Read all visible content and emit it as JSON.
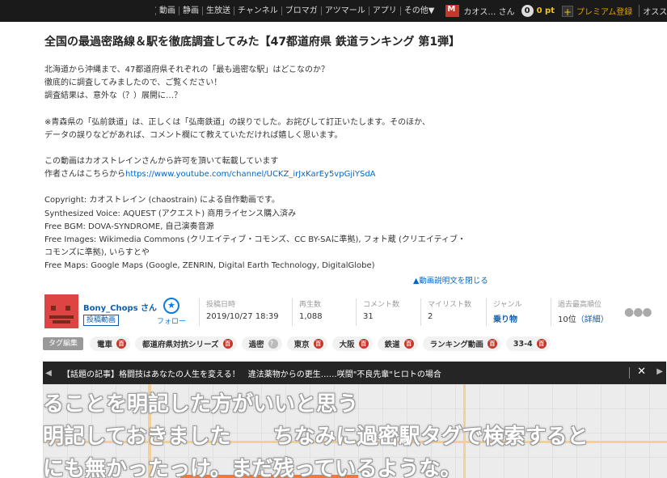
{
  "topbar": {
    "nav": [
      "動画",
      "静画",
      "生放送",
      "チャンネル",
      "ブロマガ",
      "アツマール",
      "アプリ",
      "その他▼"
    ],
    "user": "カオス… さん",
    "points": "0 pt",
    "premium": "プレミアム登録",
    "osusume": "オススメ"
  },
  "video": {
    "title": "全国の最過密路線＆駅を徹底調査してみた【47都道府県 鉄道ランキング 第1弾】",
    "description": [
      [
        "北海道から沖縄まで、47都道府県それぞれの「最も過密な駅」はどこなのか？",
        "徹底的に調査してみましたので、ご覧ください！",
        "調査結果は、意外な（？）展開に…？"
      ],
      [
        "※青森県の「弘前鉄道」は、正しくは「弘南鉄道」の誤りでした。お詫びして訂正いたします。そのほか、",
        "データの誤りなどがあれば、コメント欄にて教えていただければ嬉しく思います。"
      ],
      [
        "この動画はカオストレインさんから許可を頂いて転載しています"
      ],
      [
        "Copyright: カオストレイン (chaostrain) による自作動画です。",
        "Synthesized Voice: AQUEST (アクエスト) 商用ライセンス購入済み",
        "Free BGM: DOVA-SYNDROME, 自己演奏音源",
        "Free Images: Wikimedia Commons (クリエイティブ・コモンズ、CC BY-SAに準拠), フォト蔵 (クリエイティブ・",
        "コモンズに準拠), いらすとや",
        "Free Maps: Google Maps (Google, ZENRIN, Digital Earth Technology, DigitalGlobe)"
      ]
    ],
    "author_prefix": "作者さんはこちらから",
    "author_link": "https://www.youtube.com/channel/UCKZ_irJxKarEy5vpGjiYSdA",
    "close_description": "▲動画説明文を閉じる"
  },
  "owner": {
    "name": "Bony_Chops さん",
    "badge": "投稿動画",
    "follow": "フォロー",
    "follow_icon": "star-plus-icon"
  },
  "stats": {
    "posted_label": "投稿日時",
    "posted": "2019/10/27 18:39",
    "views_label": "再生数",
    "views": "1,088",
    "comments_label": "コメント数",
    "comments": "31",
    "mylist_label": "マイリスト数",
    "mylist": "2",
    "genre_label": "ジャンル",
    "genre": "乗り物",
    "rank_label": "過去最高順位",
    "rank": "10位",
    "rank_detail": "（詳細）"
  },
  "tags": {
    "edit_label": "タグ編集",
    "items": [
      {
        "label": "電車",
        "dic": "百"
      },
      {
        "label": "都道府県対抗シリーズ",
        "dic": "百"
      },
      {
        "label": "過密",
        "dic": "？"
      },
      {
        "label": "東京",
        "dic": "百"
      },
      {
        "label": "大阪",
        "dic": "百"
      },
      {
        "label": "鉄道",
        "dic": "百"
      },
      {
        "label": "ランキング動画",
        "dic": "百"
      },
      {
        "label": "33-4",
        "dic": "百"
      }
    ]
  },
  "news": {
    "text": "【話題の記事】格闘技はあなたの人生を変える！　違法薬物からの更生……咲間\"不良先輩\"ヒロトの場合",
    "prev": "◀",
    "next": "▶",
    "close": "✕"
  },
  "player": {
    "captions": [
      "ることを明記した方がいいと思う",
      "明記しておきました　　ちなみに過密駅タグで検索すると",
      "にも無かったっけ。まだ残っているような。"
    ]
  },
  "colors": {
    "accent": "#0b5fb3",
    "points": "#f2c40e",
    "dic_badge": "#c0392b"
  }
}
